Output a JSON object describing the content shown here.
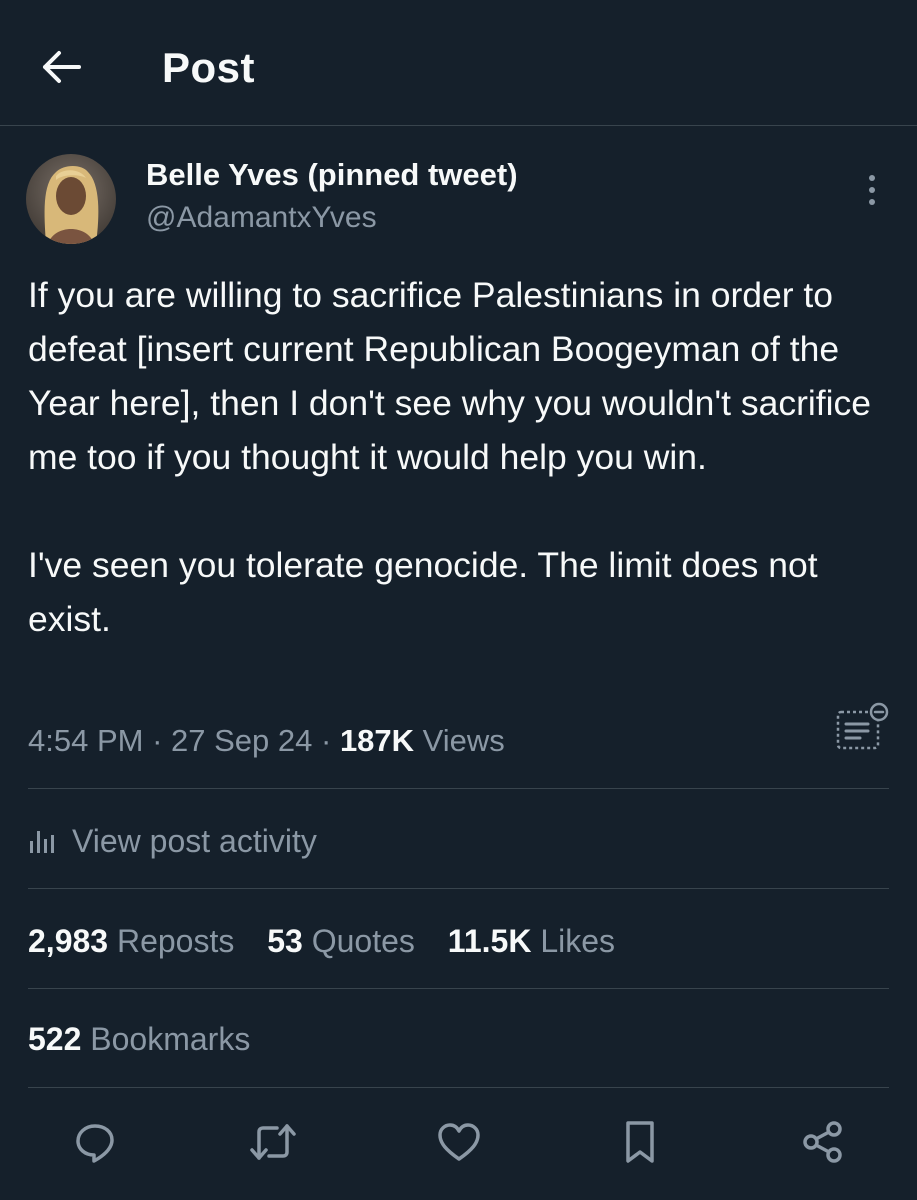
{
  "header": {
    "title": "Post",
    "back_icon": "arrow-left-icon"
  },
  "author": {
    "name": "Belle Yves (pinned tweet)",
    "handle": "@AdamantxYves",
    "avatar": "avatar-photo"
  },
  "tweet": {
    "text": "If you are willing to sacrifice Palestinians in order to defeat [insert current Republican Boogeyman of the Year here], then I don't see why you wouldn't sacrifice me too if you thought it would help you win.\n\nI've seen you tolerate genocide. The limit does not exist."
  },
  "meta": {
    "time": "4:54 PM",
    "sep1": " · ",
    "date": "27 Sep 24",
    "sep2": " · ",
    "views_count": "187K",
    "views_label": "Views"
  },
  "activity": {
    "label": "View post activity"
  },
  "stats": {
    "reposts_count": "2,983",
    "reposts_label": "Reposts",
    "quotes_count": "53",
    "quotes_label": "Quotes",
    "likes_count": "11.5K",
    "likes_label": "Likes",
    "bookmarks_count": "522",
    "bookmarks_label": "Bookmarks"
  },
  "actions": [
    "reply-icon",
    "repost-icon",
    "like-icon",
    "bookmark-icon",
    "share-icon"
  ],
  "colors": {
    "background": "#15202b",
    "text": "#f7f9f9",
    "secondary": "#8b98a5",
    "border": "#38444d"
  }
}
